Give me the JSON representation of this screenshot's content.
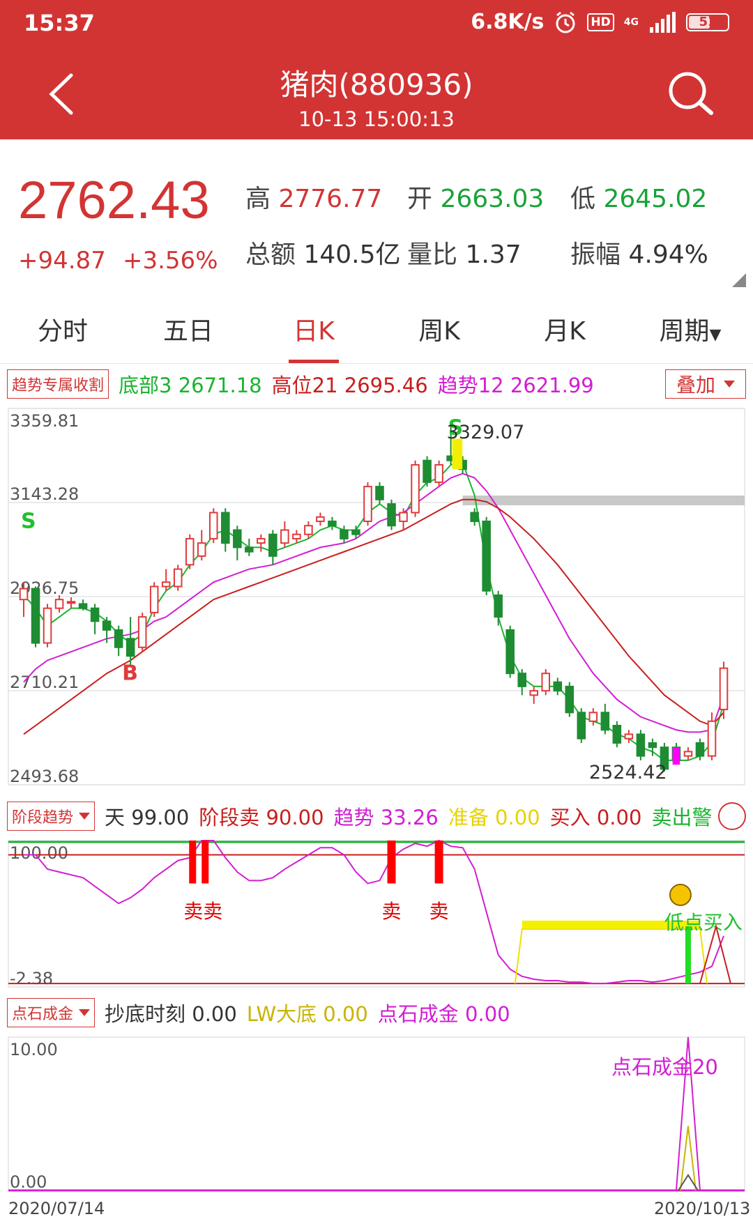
{
  "status": {
    "time": "15:37",
    "speed": "6.8K/s",
    "hd": "HD",
    "net": "4G",
    "battery": "51"
  },
  "header": {
    "title": "猪肉(880936)",
    "datetime": "10-13 15:00:13"
  },
  "quote": {
    "price": "2762.43",
    "change": "+94.87",
    "change_pct": "+3.56%",
    "high_label": "高",
    "high": "2776.77",
    "open_label": "开",
    "open": "2663.03",
    "low_label": "低",
    "low": "2645.02",
    "amount_label": "总额",
    "amount": "140.5亿",
    "ratio_label": "量比",
    "ratio": "1.37",
    "amp_label": "振幅",
    "amp": "4.94%"
  },
  "tabs": [
    {
      "label": "分时"
    },
    {
      "label": "五日"
    },
    {
      "label": "日K"
    },
    {
      "label": "周K"
    },
    {
      "label": "月K"
    },
    {
      "label": "周期"
    }
  ],
  "main_indicator": {
    "name": "趋势专属收割",
    "items": [
      {
        "label": "底部3",
        "value": "2671.18"
      },
      {
        "label": "高位21",
        "value": "2695.46"
      },
      {
        "label": "趋势12",
        "value": "2621.99"
      }
    ],
    "overlay_label": "叠加",
    "colors": {
      "bottom": "#19b42f",
      "high": "#c81e1e",
      "trend": "#d21ed2"
    }
  },
  "sub1": {
    "name": "阶段趋势",
    "items": [
      {
        "label": "天",
        "value": "99.00"
      },
      {
        "label": "阶段卖",
        "value": "90.00"
      },
      {
        "label": "趋势",
        "value": "33.26"
      },
      {
        "label": "准备",
        "value": "0.00"
      },
      {
        "label": "买入",
        "value": "0.00"
      },
      {
        "label": "卖出警",
        "value": ""
      }
    ]
  },
  "sub2": {
    "name": "点石成金",
    "items": [
      {
        "label": "抄底时刻",
        "value": "0.00"
      },
      {
        "label": "LW大底",
        "value": "0.00"
      },
      {
        "label": "点石成金",
        "value": "0.00"
      }
    ]
  },
  "chart_data": [
    {
      "type": "candlestick",
      "ylim": [
        2493.68,
        3359.81
      ],
      "y_ticks": [
        "3359.81",
        "3143.28",
        "2926.75",
        "2710.21",
        "2493.68"
      ],
      "annotations": {
        "max": "3329.07",
        "min": "2524.42",
        "buy_marker": "B",
        "sell_marker": "S"
      },
      "candles": [
        [
          2920,
          2945,
          2880,
          2960
        ],
        [
          2945,
          2820,
          2810,
          2950
        ],
        [
          2820,
          2900,
          2810,
          2910
        ],
        [
          2900,
          2920,
          2890,
          2930
        ],
        [
          2915,
          2915,
          2900,
          2925
        ],
        [
          2910,
          2900,
          2895,
          2920
        ],
        [
          2900,
          2870,
          2840,
          2910
        ],
        [
          2870,
          2850,
          2820,
          2880
        ],
        [
          2850,
          2810,
          2790,
          2860
        ],
        [
          2830,
          2790,
          2770,
          2880
        ],
        [
          2810,
          2880,
          2800,
          2890
        ],
        [
          2890,
          2950,
          2880,
          2960
        ],
        [
          2950,
          2960,
          2940,
          2990
        ],
        [
          2950,
          2990,
          2940,
          3000
        ],
        [
          3000,
          3060,
          2990,
          3070
        ],
        [
          3020,
          3050,
          3010,
          3080
        ],
        [
          3060,
          3120,
          3050,
          3130
        ],
        [
          3120,
          3050,
          3030,
          3130
        ],
        [
          3080,
          3040,
          3010,
          3090
        ],
        [
          3040,
          3030,
          3020,
          3060
        ],
        [
          3050,
          3060,
          3030,
          3070
        ],
        [
          3070,
          3020,
          3000,
          3080
        ],
        [
          3050,
          3080,
          3040,
          3100
        ],
        [
          3060,
          3070,
          3050,
          3080
        ],
        [
          3070,
          3090,
          3060,
          3100
        ],
        [
          3100,
          3110,
          3090,
          3120
        ],
        [
          3100,
          3090,
          3080,
          3110
        ],
        [
          3080,
          3060,
          3050,
          3090
        ],
        [
          3080,
          3070,
          3060,
          3090
        ],
        [
          3100,
          3180,
          3090,
          3190
        ],
        [
          3180,
          3150,
          3140,
          3190
        ],
        [
          3140,
          3090,
          3080,
          3150
        ],
        [
          3100,
          3120,
          3080,
          3130
        ],
        [
          3120,
          3230,
          3110,
          3240
        ],
        [
          3240,
          3190,
          3180,
          3250
        ],
        [
          3190,
          3230,
          3180,
          3240
        ],
        [
          3250,
          3240,
          3230,
          3329
        ],
        [
          3240,
          3220,
          3210,
          3250
        ],
        [
          3120,
          3100,
          3090,
          3130
        ],
        [
          3100,
          2940,
          2930,
          3110
        ],
        [
          2930,
          2880,
          2860,
          2940
        ],
        [
          2850,
          2750,
          2740,
          2860
        ],
        [
          2750,
          2720,
          2700,
          2760
        ],
        [
          2700,
          2710,
          2680,
          2720
        ],
        [
          2710,
          2750,
          2700,
          2760
        ],
        [
          2730,
          2710,
          2700,
          2740
        ],
        [
          2720,
          2660,
          2650,
          2730
        ],
        [
          2660,
          2600,
          2590,
          2670
        ],
        [
          2640,
          2660,
          2630,
          2670
        ],
        [
          2660,
          2620,
          2610,
          2680
        ],
        [
          2630,
          2590,
          2580,
          2640
        ],
        [
          2600,
          2610,
          2590,
          2620
        ],
        [
          2610,
          2560,
          2550,
          2620
        ],
        [
          2590,
          2580,
          2560,
          2600
        ],
        [
          2580,
          2530,
          2524,
          2590
        ],
        [
          2580,
          2550,
          2540,
          2590
        ],
        [
          2560,
          2570,
          2550,
          2580
        ],
        [
          2590,
          2560,
          2550,
          2600
        ],
        [
          2560,
          2640,
          2550,
          2660
        ],
        [
          2667,
          2762,
          2645,
          2777
        ]
      ],
      "series": [
        {
          "values": [
            2930,
            2900,
            2860,
            2880,
            2900,
            2900,
            2890,
            2870,
            2840,
            2820,
            2840,
            2900,
            2940,
            2960,
            3000,
            3030,
            3070,
            3080,
            3060,
            3040,
            3040,
            3030,
            3040,
            3050,
            3060,
            3080,
            3090,
            3080,
            3080,
            3120,
            3140,
            3120,
            3110,
            3160,
            3190,
            3200,
            3230,
            3235,
            3160,
            3000,
            2880,
            2790,
            2740,
            2720,
            2720,
            2720,
            2690,
            2650,
            2640,
            2630,
            2610,
            2600,
            2580,
            2570,
            2550,
            2550,
            2550,
            2560,
            2590,
            2680
          ]
        },
        {
          "values": [
            2730,
            2760,
            2780,
            2790,
            2800,
            2810,
            2820,
            2830,
            2835,
            2840,
            2850,
            2870,
            2880,
            2900,
            2920,
            2940,
            2960,
            2970,
            2980,
            2990,
            2995,
            3000,
            3010,
            3020,
            3030,
            3040,
            3045,
            3050,
            3060,
            3080,
            3100,
            3110,
            3120,
            3140,
            3160,
            3180,
            3200,
            3210,
            3200,
            3170,
            3130,
            3080,
            3030,
            2980,
            2930,
            2880,
            2830,
            2790,
            2750,
            2720,
            2690,
            2670,
            2650,
            2640,
            2630,
            2620,
            2615,
            2615,
            2620,
            2700
          ]
        },
        {
          "values": [
            2610,
            2630,
            2650,
            2670,
            2690,
            2710,
            2730,
            2750,
            2765,
            2780,
            2800,
            2820,
            2840,
            2860,
            2880,
            2900,
            2920,
            2930,
            2940,
            2950,
            2960,
            2970,
            2980,
            2990,
            3000,
            3010,
            3020,
            3030,
            3040,
            3050,
            3060,
            3070,
            3080,
            3095,
            3110,
            3125,
            3140,
            3150,
            3150,
            3145,
            3130,
            3110,
            3085,
            3060,
            3030,
            3000,
            2965,
            2930,
            2895,
            2860,
            2825,
            2790,
            2760,
            2730,
            2700,
            2680,
            2660,
            2640,
            2630,
            2660
          ]
        }
      ]
    },
    {
      "type": "line",
      "ylim": [
        -2.38,
        100.0
      ],
      "y_ticks": [
        "100.00",
        "-2.38"
      ],
      "labels": {
        "sell": "卖",
        "double_sell": "卖卖",
        "low_buy": "低点买入"
      },
      "series": [
        {
          "values": [
            90,
            90,
            80,
            78,
            76,
            74,
            68,
            62,
            56,
            60,
            66,
            74,
            80,
            86,
            88,
            100,
            100,
            88,
            78,
            72,
            72,
            74,
            80,
            85,
            90,
            95,
            95,
            90,
            78,
            70,
            72,
            88,
            94,
            98,
            96,
            100,
            96,
            95,
            80,
            50,
            20,
            10,
            5,
            3,
            2,
            2,
            1,
            1,
            0,
            0,
            1,
            2,
            2,
            1,
            2,
            4,
            6,
            8,
            12,
            33.26
          ]
        }
      ]
    },
    {
      "type": "line",
      "ylim": [
        0.0,
        10.0
      ],
      "y_ticks": [
        "10.00",
        "0.00"
      ],
      "x_ticks": [
        "2020/07/14",
        "2020/10/13"
      ],
      "labels": {
        "peak": "点石成金20"
      },
      "series": [
        {
          "values": [
            0,
            0,
            0,
            0,
            0,
            0,
            0,
            0,
            0,
            0,
            0,
            0,
            0,
            0,
            0,
            0,
            0,
            0,
            0,
            0,
            0,
            0,
            0,
            0,
            0,
            0,
            0,
            0,
            0,
            0,
            0,
            0,
            0,
            0,
            0,
            0,
            0,
            0,
            0,
            0,
            0,
            0,
            0,
            0,
            0,
            0,
            0,
            0,
            0,
            0,
            0,
            0,
            0,
            0,
            0,
            0,
            10,
            0,
            0,
            0
          ]
        }
      ]
    }
  ]
}
